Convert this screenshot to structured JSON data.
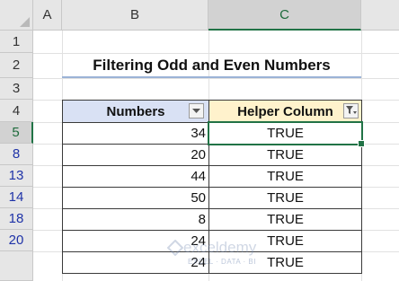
{
  "columns": [
    "A",
    "B",
    "C"
  ],
  "rows": [
    "1",
    "2",
    "3",
    "4",
    "5",
    "8",
    "13",
    "14",
    "18",
    "20"
  ],
  "title": "Filtering Odd and Even Numbers",
  "table": {
    "headers": [
      "Numbers",
      "Helper Column"
    ],
    "data": [
      [
        "34",
        "TRUE"
      ],
      [
        "20",
        "TRUE"
      ],
      [
        "44",
        "TRUE"
      ],
      [
        "50",
        "TRUE"
      ],
      [
        "8",
        "TRUE"
      ],
      [
        "24",
        "TRUE"
      ],
      [
        "24",
        "TRUE"
      ]
    ]
  },
  "icons": {
    "numbers_filter": "dropdown-arrow-icon",
    "helper_filter": "filter-funnel-icon"
  },
  "watermark": {
    "name": "exceldemy",
    "sub": "EXCEL · DATA · BI"
  },
  "colors": {
    "accent": "#217346",
    "header_b": "#d9e1f4",
    "header_c": "#fff2cc",
    "row_numbers": "#1f33a8"
  }
}
